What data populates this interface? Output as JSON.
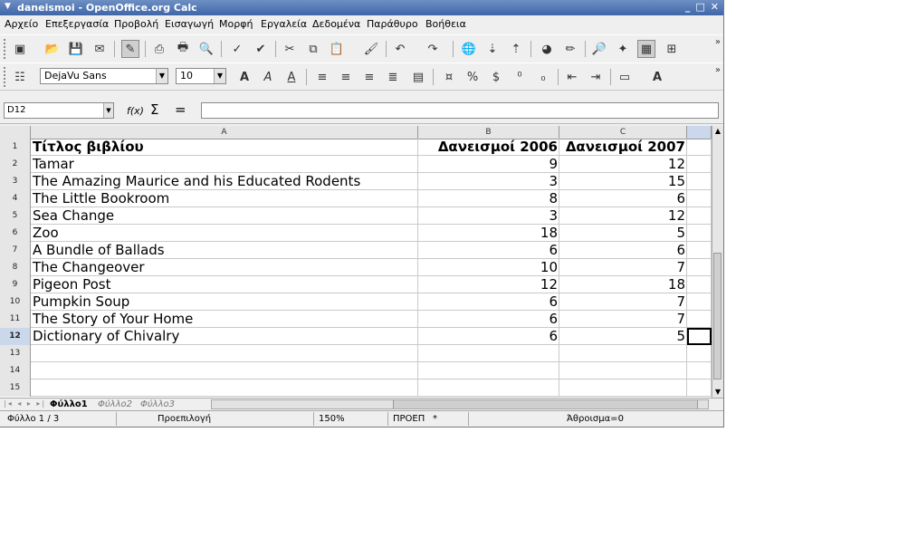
{
  "window": {
    "title": "daneismoi - OpenOffice.org Calc"
  },
  "menu": [
    "Αρχείο",
    "Επεξεργασία",
    "Προβολή",
    "Εισαγωγή",
    "Μορφή",
    "Εργαλεία",
    "Δεδομένα",
    "Παράθυρο",
    "Βοήθεια"
  ],
  "formatting": {
    "font_name": "DejaVu Sans",
    "font_size": "10"
  },
  "formula_bar": {
    "cell_ref": "D12",
    "content": ""
  },
  "columns": [
    "A",
    "B",
    "C"
  ],
  "header_row": {
    "a": "Τίτλος βιβλίου",
    "b": "Δανεισμοί 2006",
    "c": "Δανεισμοί 2007"
  },
  "rows": [
    {
      "title": "Tamar",
      "y2006": "9",
      "y2007": "12"
    },
    {
      "title": "The Amazing Maurice and his Educated Rodents",
      "y2006": "3",
      "y2007": "15"
    },
    {
      "title": "The Little Bookroom",
      "y2006": "8",
      "y2007": "6"
    },
    {
      "title": "Sea Change",
      "y2006": "3",
      "y2007": "12"
    },
    {
      "title": "Zoo",
      "y2006": "18",
      "y2007": "5"
    },
    {
      "title": "A Bundle of Ballads",
      "y2006": "6",
      "y2007": "6"
    },
    {
      "title": "The Changeover",
      "y2006": "10",
      "y2007": "7"
    },
    {
      "title": "Pigeon Post",
      "y2006": "12",
      "y2007": "18"
    },
    {
      "title": "Pumpkin Soup",
      "y2006": "6",
      "y2007": "7"
    },
    {
      "title": "The Story of Your Home",
      "y2006": "6",
      "y2007": "7"
    },
    {
      "title": "Dictionary of Chivalry",
      "y2006": "6",
      "y2007": "5"
    }
  ],
  "row_numbers": [
    "1",
    "2",
    "3",
    "4",
    "5",
    "6",
    "7",
    "8",
    "9",
    "10",
    "11",
    "12",
    "13",
    "14",
    "15"
  ],
  "sheets": [
    "Φύλλο1",
    "Φύλλο2",
    "Φύλλο3"
  ],
  "status": {
    "sheet": "Φύλλο 1 / 3",
    "page_style": "Προεπιλογή",
    "zoom": "150%",
    "mode": "ΠΡΟΕΠ",
    "modified": "*",
    "sum": "Άθροισμα=0"
  }
}
